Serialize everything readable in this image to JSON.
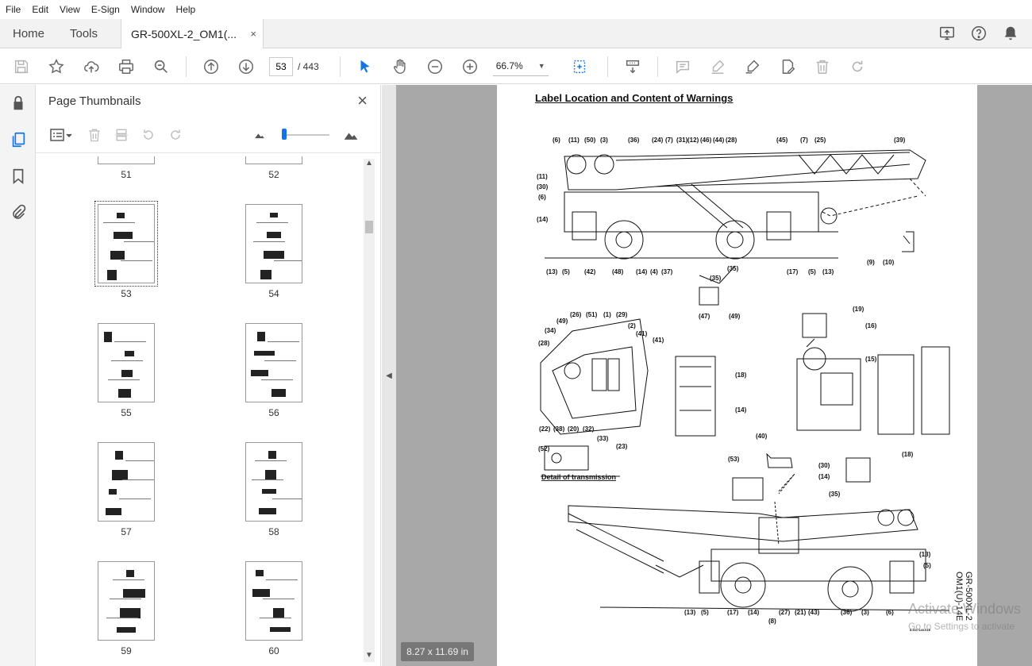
{
  "menu": [
    "File",
    "Edit",
    "View",
    "E-Sign",
    "Window",
    "Help"
  ],
  "tabs": {
    "home": "Home",
    "tools": "Tools",
    "document": "GR-500XL-2_OM1(...",
    "close": "×"
  },
  "toolbar": {
    "current_page": "53",
    "total_pages": "/ 443",
    "zoom": "66.7%"
  },
  "panel": {
    "title": "Page Thumbnails",
    "close": "×"
  },
  "thumbnails": [
    {
      "num": "51"
    },
    {
      "num": "52"
    },
    {
      "num": "53"
    },
    {
      "num": "54"
    },
    {
      "num": "55"
    },
    {
      "num": "56"
    },
    {
      "num": "57"
    },
    {
      "num": "58"
    },
    {
      "num": "59"
    },
    {
      "num": "60"
    }
  ],
  "document": {
    "title": "Label Location and Content of Warnings",
    "detail_caption": "Detail of transmission",
    "side_code": "GR-500XL-2 OM1(U)-14E",
    "drawing_code": "ILG07145-01E",
    "callouts_top": [
      "(6)",
      "(11)",
      "(50)",
      "(3)",
      "(36)",
      "(24)",
      "(7)",
      "(31)",
      "(12)",
      "(46)",
      "(44)",
      "(28)",
      "(45)",
      "(7)",
      "(25)",
      "(39)",
      "(11)",
      "(30)",
      "(6)",
      "(14)",
      "(13)",
      "(5)",
      "(42)",
      "(48)",
      "(14)",
      "(4)",
      "(37)",
      "(35)",
      "(17)",
      "(5)",
      "(13)",
      "(9)",
      "(10)",
      "(35)",
      "(47)",
      "(49)"
    ],
    "callouts_mid": [
      "(26)",
      "(51)",
      "(1)",
      "(29)",
      "(49)",
      "(34)",
      "(2)",
      "(41)",
      "(28)",
      "(41)",
      "(22)",
      "(38)",
      "(20)",
      "(32)",
      "(33)",
      "(23)",
      "(52)",
      "(18)",
      "(14)",
      "(19)",
      "(16)",
      "(15)",
      "(18)",
      "(40)",
      "(30)",
      "(14)",
      "(53)"
    ],
    "callouts_bottom": [
      "(35)",
      "(13)",
      "(5)",
      "(13)",
      "(5)",
      "(17)",
      "(14)",
      "(27)",
      "(21)",
      "(43)",
      "(36)",
      "(3)",
      "(6)",
      "(8)"
    ]
  },
  "status": {
    "page_size": "8.27 x 11.69 in"
  },
  "watermark": {
    "line1": "Activate Windows",
    "line2": "Go to Settings to activate"
  }
}
